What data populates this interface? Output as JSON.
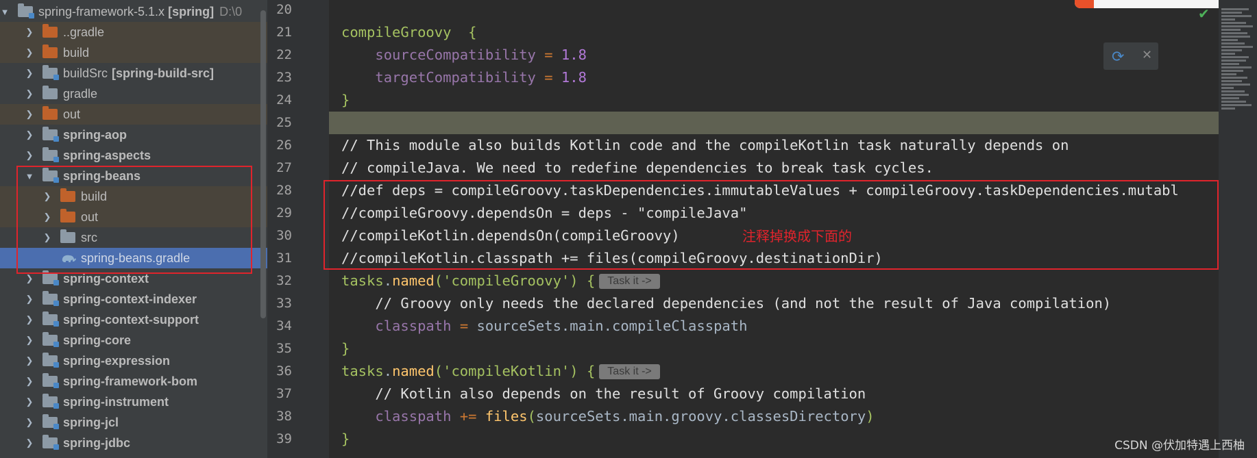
{
  "project_tree": {
    "root": {
      "name": "spring-framework-5.1.x",
      "tag": "[spring]",
      "path": "D:\\0"
    },
    "items": [
      {
        "label": "..gradle",
        "kind": "folder-orange",
        "indent": 1,
        "bold": false
      },
      {
        "label": "build",
        "kind": "folder-orange",
        "indent": 1,
        "bold": false
      },
      {
        "label": "buildSrc",
        "suffix": "[spring-build-src]",
        "kind": "module",
        "indent": 1,
        "bold": false
      },
      {
        "label": "gradle",
        "kind": "folder-src",
        "indent": 1,
        "bold": false
      },
      {
        "label": "out",
        "kind": "folder-orange",
        "indent": 1,
        "bold": false
      },
      {
        "label": "spring-aop",
        "kind": "module",
        "indent": 1,
        "bold": true
      },
      {
        "label": "spring-aspects",
        "kind": "module",
        "indent": 1,
        "bold": true
      },
      {
        "label": "spring-beans",
        "kind": "module",
        "indent": 1,
        "bold": true,
        "expanded": true
      },
      {
        "label": "build",
        "kind": "folder-orange",
        "indent": 2,
        "bold": false
      },
      {
        "label": "out",
        "kind": "folder-orange",
        "indent": 2,
        "bold": false
      },
      {
        "label": "src",
        "kind": "folder-src",
        "indent": 2,
        "bold": false
      },
      {
        "label": "spring-beans.gradle",
        "kind": "gradle-file",
        "indent": 2,
        "bold": false,
        "selected": true
      },
      {
        "label": "spring-context",
        "kind": "module",
        "indent": 1,
        "bold": true
      },
      {
        "label": "spring-context-indexer",
        "kind": "module",
        "indent": 1,
        "bold": true
      },
      {
        "label": "spring-context-support",
        "kind": "module",
        "indent": 1,
        "bold": true
      },
      {
        "label": "spring-core",
        "kind": "module",
        "indent": 1,
        "bold": true
      },
      {
        "label": "spring-expression",
        "kind": "module",
        "indent": 1,
        "bold": true
      },
      {
        "label": "spring-framework-bom",
        "kind": "module",
        "indent": 1,
        "bold": true
      },
      {
        "label": "spring-instrument",
        "kind": "module",
        "indent": 1,
        "bold": true
      },
      {
        "label": "spring-jcl",
        "kind": "module",
        "indent": 1,
        "bold": true
      },
      {
        "label": "spring-jdbc",
        "kind": "module",
        "indent": 1,
        "bold": true
      }
    ]
  },
  "editor": {
    "lines": [
      {
        "num": "20",
        "tokens": []
      },
      {
        "num": "21",
        "run": true,
        "fold": true,
        "tokens": [
          [
            "kw-g",
            "compileGroovy"
          ],
          [
            "",
            "  "
          ],
          [
            "par",
            "{"
          ]
        ]
      },
      {
        "num": "22",
        "tokens": [
          [
            "",
            "    "
          ],
          [
            "prop",
            "sourceCompatibility"
          ],
          [
            "",
            " "
          ],
          [
            "op",
            "="
          ],
          [
            "",
            " "
          ],
          [
            "num",
            "1.8"
          ]
        ]
      },
      {
        "num": "23",
        "tokens": [
          [
            "",
            "    "
          ],
          [
            "prop",
            "targetCompatibility"
          ],
          [
            "",
            " "
          ],
          [
            "op",
            "="
          ],
          [
            "",
            " "
          ],
          [
            "num",
            "1.8"
          ]
        ]
      },
      {
        "num": "24",
        "fold": true,
        "tokens": [
          [
            "par",
            "}"
          ]
        ]
      },
      {
        "num": "25",
        "current": true,
        "tokens": []
      },
      {
        "num": "26",
        "fold": true,
        "tokens": [
          [
            "com",
            "// This module also builds Kotlin code and the compileKotlin task naturally depends on"
          ]
        ]
      },
      {
        "num": "27",
        "tokens": [
          [
            "com",
            "// compileJava. We need to redefine dependencies to break task cycles."
          ]
        ]
      },
      {
        "num": "28",
        "tokens": [
          [
            "com",
            "//def deps = compileGroovy.taskDependencies.immutableValues + compileGroovy.taskDependencies.mutabl"
          ]
        ]
      },
      {
        "num": "29",
        "tokens": [
          [
            "com",
            "//compileGroovy.dependsOn = deps - \"compileJava\""
          ]
        ]
      },
      {
        "num": "30",
        "tokens": [
          [
            "com",
            "//compileKotlin.dependsOn(compileGroovy)"
          ]
        ]
      },
      {
        "num": "31",
        "fold": true,
        "tokens": [
          [
            "com",
            "//compileKotlin.classpath += files(compileGroovy.destinationDir)"
          ]
        ]
      },
      {
        "num": "32",
        "fold": true,
        "hint": "Task it ->",
        "tokens": [
          [
            "kw-g",
            "tasks"
          ],
          [
            "",
            "."
          ],
          [
            "fn",
            "named"
          ],
          [
            "par",
            "("
          ],
          [
            "str",
            "'compileGroovy'"
          ],
          [
            "par",
            ")"
          ],
          [
            "",
            " "
          ],
          [
            "par",
            "{"
          ]
        ]
      },
      {
        "num": "33",
        "tokens": [
          [
            "",
            "    "
          ],
          [
            "com",
            "// Groovy only needs the declared dependencies (and not the result of Java compilation)"
          ]
        ]
      },
      {
        "num": "34",
        "tokens": [
          [
            "",
            "    "
          ],
          [
            "prop",
            "classpath"
          ],
          [
            "",
            " "
          ],
          [
            "op",
            "="
          ],
          [
            "",
            " sourceSets.main.compileClasspath"
          ]
        ]
      },
      {
        "num": "35",
        "fold": true,
        "tokens": [
          [
            "par",
            "}"
          ]
        ]
      },
      {
        "num": "36",
        "fold": true,
        "hint": "Task it ->",
        "tokens": [
          [
            "kw-g",
            "tasks"
          ],
          [
            "",
            "."
          ],
          [
            "fn",
            "named"
          ],
          [
            "par",
            "("
          ],
          [
            "str",
            "'compileKotlin'"
          ],
          [
            "par",
            ")"
          ],
          [
            "",
            " "
          ],
          [
            "par",
            "{"
          ]
        ]
      },
      {
        "num": "37",
        "tokens": [
          [
            "",
            "    "
          ],
          [
            "com",
            "// Kotlin also depends on the result of Groovy compilation"
          ]
        ]
      },
      {
        "num": "38",
        "tokens": [
          [
            "",
            "    "
          ],
          [
            "prop",
            "classpath"
          ],
          [
            "",
            " "
          ],
          [
            "op",
            "+="
          ],
          [
            "",
            " "
          ],
          [
            "fn",
            "files"
          ],
          [
            "par",
            "("
          ],
          [
            "",
            "sourceSets.main.groovy.classesDirectory"
          ],
          [
            "par",
            ")"
          ]
        ]
      },
      {
        "num": "39",
        "fold": true,
        "tokens": [
          [
            "par",
            "}"
          ]
        ]
      }
    ]
  },
  "annotation": {
    "text": "注释掉换成下面的",
    "color": "#e0242c"
  },
  "watermark": "CSDN @伏加特遇上西柚",
  "colors": {
    "selection": "#4b6eaf",
    "current_line": "#5f6152",
    "annotation_red": "#e0242c"
  }
}
